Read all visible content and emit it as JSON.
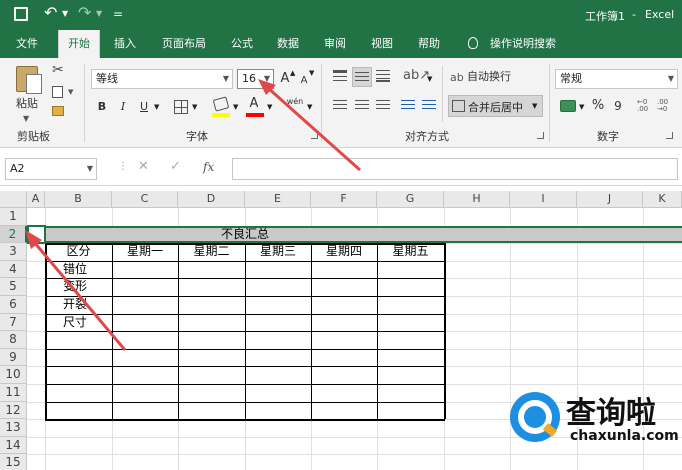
{
  "titlebar": {
    "document": "工作簿1",
    "separator": "-",
    "app": "Excel",
    "customize": "="
  },
  "tabs": [
    "文件",
    "开始",
    "插入",
    "页面布局",
    "公式",
    "数据",
    "审阅",
    "视图",
    "帮助"
  ],
  "tell_me": "操作说明搜索",
  "ribbon": {
    "clipboard": {
      "paste": "粘贴",
      "group": "剪贴板"
    },
    "font": {
      "name": "等线",
      "size": "16",
      "grow": "A",
      "shrink": "A",
      "bold": "B",
      "italic": "I",
      "underline": "U",
      "font_color": "A",
      "wen": "wén",
      "group": "字体"
    },
    "alignment": {
      "wrap_text": "自动换行",
      "merge_center": "合并后居中",
      "group": "对齐方式"
    },
    "number": {
      "format": "常规",
      "percent": "%",
      "comma": "9",
      "group": "数字"
    }
  },
  "formula_bar": {
    "name_box": "A2",
    "fx": "fx",
    "content": ""
  },
  "sheet": {
    "columns": [
      "A",
      "B",
      "C",
      "D",
      "E",
      "F",
      "G",
      "H",
      "I",
      "J",
      "K"
    ],
    "rows": [
      "1",
      "2",
      "3",
      "4",
      "5",
      "6",
      "7",
      "8",
      "9",
      "10",
      "11",
      "12",
      "13",
      "14",
      "15"
    ],
    "merged_title": "不良汇总",
    "headers": [
      "区分",
      "星期一",
      "星期二",
      "星期三",
      "星期四",
      "星期五"
    ],
    "categories": [
      "错位",
      "变形",
      "开裂",
      "尺寸"
    ]
  },
  "watermark": {
    "brand": "查询啦",
    "url": "chaxunla.com"
  },
  "colors": {
    "accent": "#217346",
    "annotation_arrow": "#e0484a",
    "merged_fill": "#c9c9c9"
  }
}
